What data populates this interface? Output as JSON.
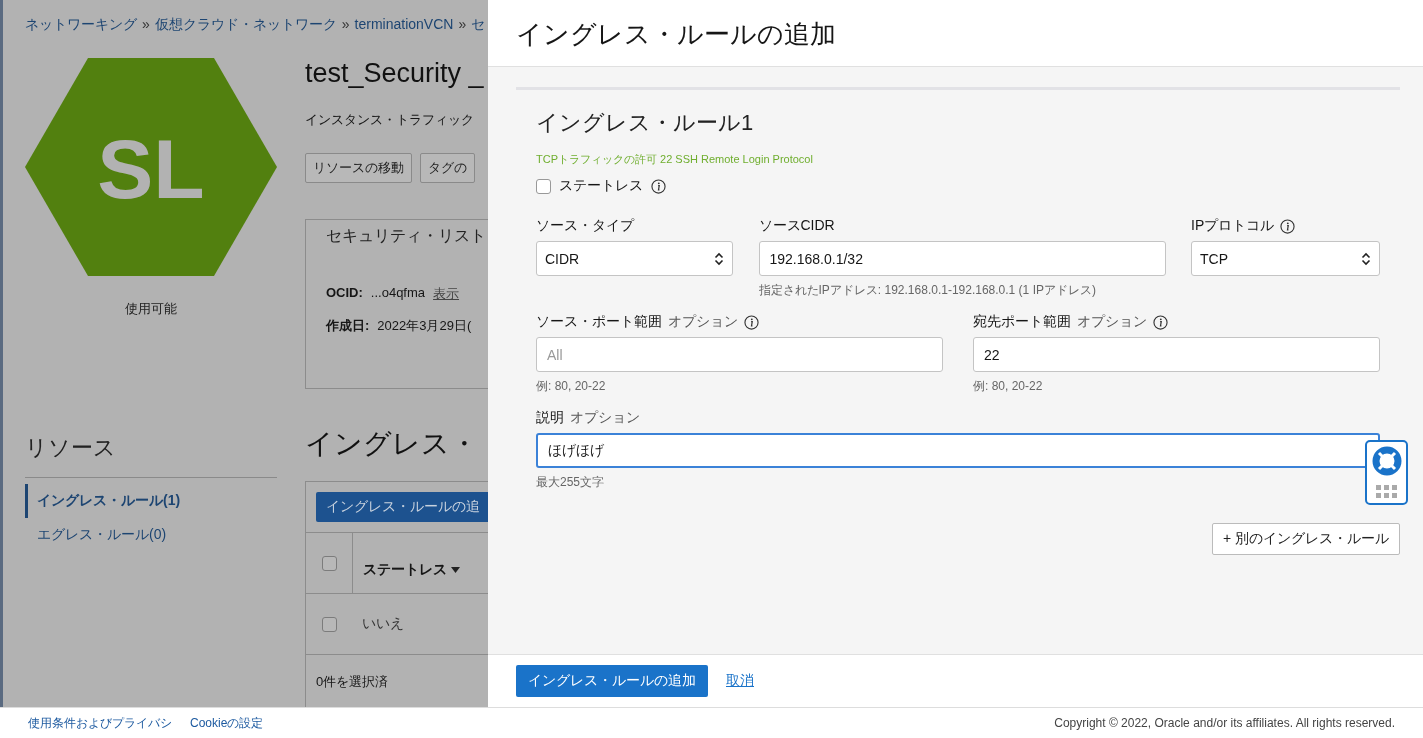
{
  "breadcrumb": {
    "separator": "»",
    "items": [
      {
        "label": "ネットワーキング"
      },
      {
        "label": "仮想クラウド・ネットワーク"
      },
      {
        "label": "terminationVCN"
      },
      {
        "label": "セ"
      }
    ]
  },
  "resource": {
    "logo_text": "SL",
    "status": "使用可能",
    "title": "test_Security _",
    "description": "インスタンス・トラフィック",
    "actions": [
      "リソースの移動",
      "タグの"
    ],
    "info_card": {
      "title": "セキュリティ・リスト",
      "ocid_label": "OCID:",
      "ocid_value": "...o4qfma",
      "ocid_link": "表示",
      "created_label": "作成日:",
      "created_value": "2022年3月29日("
    }
  },
  "sidebar": {
    "title": "リソース",
    "items": [
      {
        "label": "イングレス・ルール(1)",
        "selected": true
      },
      {
        "label": "エグレス・ルール(0)",
        "selected": false
      }
    ]
  },
  "rules_section": {
    "heading": "イングレス・",
    "add_button": "イングレス・ルールの追",
    "header_checked": false,
    "column": "ステートレス",
    "rows": [
      {
        "checked": false,
        "stateless": "いいえ"
      }
    ],
    "selection_count": "0件を選択済"
  },
  "panel": {
    "title": "イングレス・ルールの追加",
    "rules": [
      {
        "title": "イングレス・ルール1",
        "summary": "TCPトラフィックの許可 22 SSH Remote Login Protocol",
        "stateless": {
          "label": "ステートレス",
          "checked": false,
          "info": true
        },
        "rows": [
          [
            {
              "kind": "select",
              "label": "ソース・タイプ",
              "info": false,
              "value": "CIDR"
            },
            {
              "kind": "text",
              "label": "ソースCIDR",
              "info": false,
              "value": "192.168.0.1/32",
              "hint": "指定されたIPアドレス: 192.168.0.1-192.168.0.1 (1 IPアドレス)"
            },
            {
              "kind": "select",
              "label": "IPプロトコル",
              "info": true,
              "value": "TCP"
            }
          ],
          [
            {
              "kind": "text",
              "label": "ソース・ポート範囲",
              "optional": "オプション",
              "info": true,
              "placeholder": "All",
              "hint": "例: 80, 20-22"
            },
            {
              "kind": "text",
              "label": "宛先ポート範囲",
              "optional": "オプション",
              "info": true,
              "value": "22",
              "hint": "例: 80, 20-22"
            }
          ],
          [
            {
              "kind": "text",
              "label": "説明",
              "optional": "オプション",
              "info": false,
              "value": "ほげほげ",
              "focused": true,
              "hint": "最大255文字"
            }
          ]
        ]
      }
    ],
    "add_another": "+ 別のイングレス・ルール",
    "submit": "イングレス・ルールの追加",
    "cancel": "取消"
  },
  "footer": {
    "links": [
      "使用条件およびプライバシ",
      "Cookieの設定"
    ],
    "copyright": "Copyright © 2022, Oracle and/or its affiliates. All rights reserved."
  }
}
